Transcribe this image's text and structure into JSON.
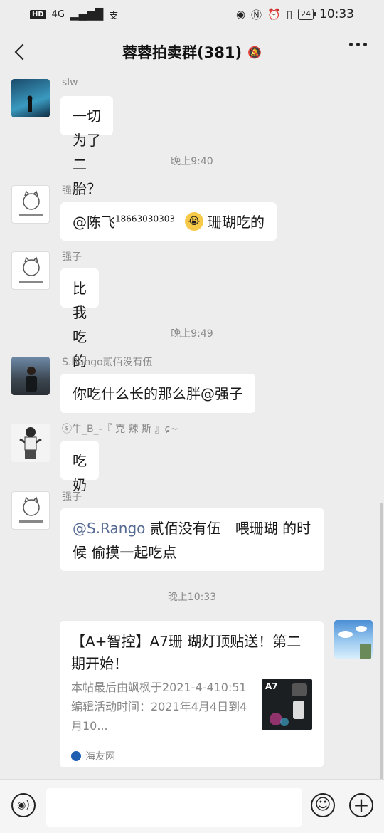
{
  "status_bar": {
    "left": {
      "hd": "HD",
      "network": "4G",
      "extra": "支"
    },
    "battery": "24",
    "time": "10:33"
  },
  "header": {
    "title": "蓉蓉拍卖群(381)",
    "back_icon": "chevron-left-icon",
    "mute_icon": "bell-muted-icon",
    "more_icon": "more-dots-icon"
  },
  "messages": [
    {
      "sender": "slw",
      "text": "一切为了二胎？"
    },
    {
      "time": "晚上9:40"
    },
    {
      "sender": "强子",
      "mention": "@陈飞",
      "mention_sup": "18663030303",
      "emoji": "emoji-crying-face",
      "text": "珊瑚吃的"
    },
    {
      "sender": "强子",
      "text": "比我吃的好"
    },
    {
      "time": "晚上9:49"
    },
    {
      "sender": "S.Rango贰佰没有伍",
      "text": "你吃什么长的那么胖@强子"
    },
    {
      "sender": "ⓢ牛_B_-『 克  辣  斯 』ɕ~",
      "text": "吃奶"
    },
    {
      "sender": "强子",
      "mention": "@S.Rango",
      "text": " 贰佰没有伍　喂珊瑚 的时候 偷摸一起吃点"
    },
    {
      "time": "晚上10:33"
    },
    {
      "link_card": {
        "title": "【A+智控】A7珊 瑚灯顶贴送！第二期开始！",
        "desc": "本帖最后由飒枫于2021-4-410:51编辑活动时间：2021年4月4日到4月10...",
        "thumb_label": "A7",
        "source": "海友网"
      }
    }
  ],
  "input_bar": {
    "voice_icon": "voice-icon",
    "emoji_icon": "emoji-icon",
    "plus_icon": "plus-icon",
    "placeholder": ""
  }
}
